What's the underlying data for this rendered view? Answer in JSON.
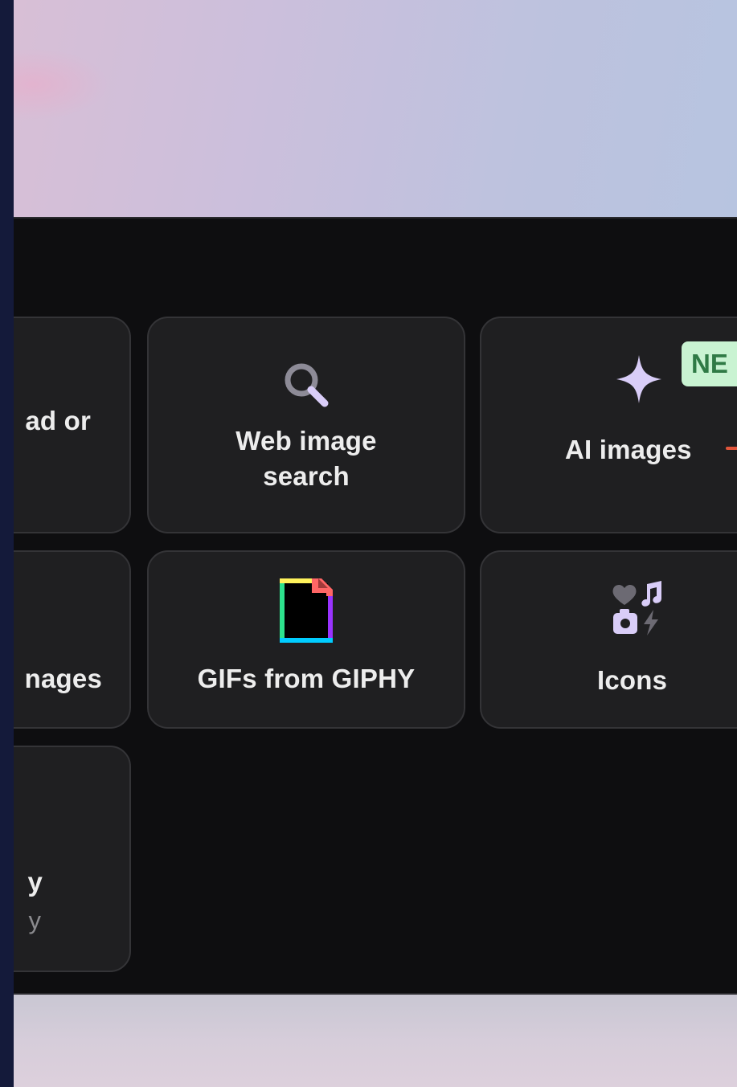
{
  "tiles": {
    "upload": {
      "label": "ad or"
    },
    "web_search": {
      "label_line1": "Web image",
      "label_line2": "search"
    },
    "ai_images": {
      "label": "AI images",
      "badge": "NE"
    },
    "stock_images": {
      "label": "nages"
    },
    "giphy": {
      "label": "GIFs from GIPHY"
    },
    "icons": {
      "label": "Icons"
    },
    "library": {
      "label": "y",
      "sublabel": "y"
    }
  },
  "icons": {
    "web_search": "search-icon",
    "ai_images": "sparkle-icon",
    "giphy": "giphy-icon",
    "icons": "icons-collection-icon"
  },
  "colors": {
    "panel_bg": "#0e0e10",
    "tile_bg": "#1f1f21",
    "tile_border": "#343437",
    "accent_lavender": "#d9cdf8",
    "badge_bg": "#c9f3d2",
    "badge_text": "#2f7a45"
  }
}
